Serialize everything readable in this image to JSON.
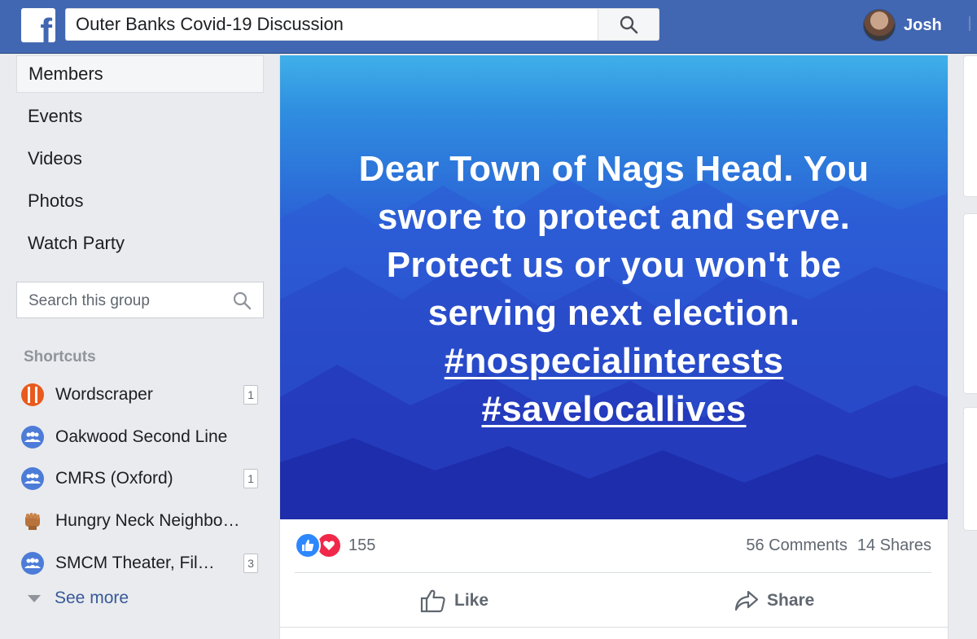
{
  "header": {
    "logo_letter": "f",
    "search_value": "Outer Banks Covid-19 Discussion",
    "user_name": "Josh"
  },
  "nav": {
    "items": [
      {
        "label": "Members"
      },
      {
        "label": "Events"
      },
      {
        "label": "Videos"
      },
      {
        "label": "Photos"
      },
      {
        "label": "Watch Party"
      }
    ],
    "group_search_placeholder": "Search this group"
  },
  "shortcuts": {
    "title": "Shortcuts",
    "items": [
      {
        "label": "Wordscraper",
        "badge": "1",
        "icon": "wordscraper-icon"
      },
      {
        "label": "Oakwood Second Line",
        "badge": "",
        "icon": "group-icon"
      },
      {
        "label": "CMRS (Oxford)",
        "badge": "1",
        "icon": "group-icon"
      },
      {
        "label": "Hungry Neck Neighborh...",
        "badge": "",
        "icon": "fist-icon"
      },
      {
        "label": "SMCM Theater, Film,...",
        "badge": "3",
        "icon": "group-icon"
      }
    ],
    "see_more": "See more"
  },
  "post": {
    "lines": [
      "Dear Town of Nags Head. You",
      "swore to protect and serve.",
      "Protect us or you won't be",
      "serving next election."
    ],
    "hashtags": [
      "#nospecialinterests",
      "#savelocallives"
    ],
    "reaction_count": "155",
    "comments": "56 Comments",
    "shares": "14 Shares",
    "like_label": "Like",
    "share_label": "Share"
  },
  "colors": {
    "brand": "#4267b2",
    "link": "#385898",
    "like": "#2d88ff",
    "love": "#f0284a"
  }
}
